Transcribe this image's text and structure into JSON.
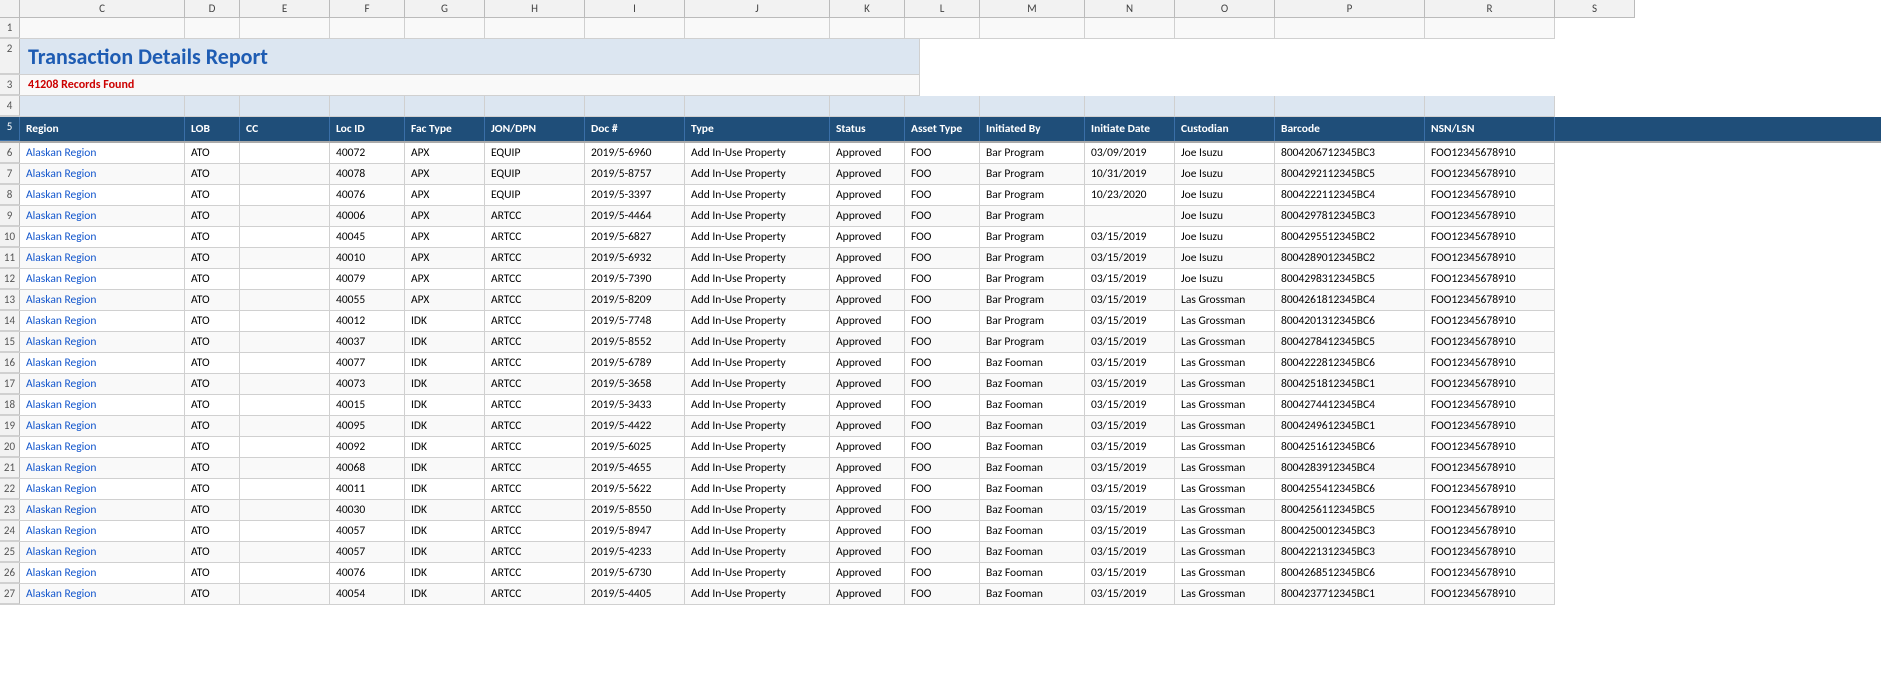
{
  "title": "Transaction Details Report",
  "records_found": "41208 Records Found",
  "columns": [
    {
      "label": "Region",
      "key": "region",
      "cls": "w-region"
    },
    {
      "label": "LOB",
      "key": "lob",
      "cls": "w-lob"
    },
    {
      "label": "CC",
      "key": "cc",
      "cls": "w-cc"
    },
    {
      "label": "Loc ID",
      "key": "loc_id",
      "cls": "w-locid"
    },
    {
      "label": "Fac Type",
      "key": "fac_type",
      "cls": "w-factype"
    },
    {
      "label": "JON/DPN",
      "key": "jon_dpn",
      "cls": "w-jondpn"
    },
    {
      "label": "Doc #",
      "key": "doc_num",
      "cls": "w-docnum"
    },
    {
      "label": "Type",
      "key": "type",
      "cls": "w-type"
    },
    {
      "label": "Status",
      "key": "status",
      "cls": "w-status"
    },
    {
      "label": "Asset Type",
      "key": "asset_type",
      "cls": "w-assettype"
    },
    {
      "label": "Initiated By",
      "key": "init_by",
      "cls": "w-initby"
    },
    {
      "label": "Initiate Date",
      "key": "init_date",
      "cls": "w-initdate"
    },
    {
      "label": "Custodian",
      "key": "custodian",
      "cls": "w-custodian"
    },
    {
      "label": "Barcode",
      "key": "barcode",
      "cls": "w-barcode"
    },
    {
      "label": "NSN/LSN",
      "key": "nsn",
      "cls": "w-nsn"
    }
  ],
  "col_letters": [
    "C",
    "D",
    "E",
    "F",
    "G",
    "H",
    "I",
    "J",
    "K",
    "L",
    "M",
    "N",
    "O",
    "P",
    "R",
    "S"
  ],
  "rows": [
    {
      "region": "Alaskan Region",
      "lob": "ATO",
      "cc": "",
      "loc_id": "40072",
      "fac_type": "APX",
      "jon_dpn": "EQUIP",
      "doc_num": "",
      "type_val": "2019/5-6960",
      "type": "Add In-Use Property",
      "status": "Approved",
      "asset_type": "FOO",
      "init_by": "Bar Program",
      "init_date": "03/09/2019",
      "custodian": "Joe Isuzu",
      "barcode": "8004206712345BC3",
      "nsn": "FOO12345678910"
    },
    {
      "region": "Alaskan Region",
      "lob": "ATO",
      "cc": "",
      "loc_id": "40078",
      "fac_type": "APX",
      "jon_dpn": "EQUIP",
      "doc_num": "",
      "type_val": "2019/5-8757",
      "type": "Add In-Use Property",
      "status": "Approved",
      "asset_type": "FOO",
      "init_by": "Bar Program",
      "init_date": "10/31/2019",
      "custodian": "Joe Isuzu",
      "barcode": "8004292112345BC5",
      "nsn": "FOO12345678910"
    },
    {
      "region": "Alaskan Region",
      "lob": "ATO",
      "cc": "",
      "loc_id": "40076",
      "fac_type": "APX",
      "jon_dpn": "EQUIP",
      "doc_num": "",
      "type_val": "2019/5-3397",
      "type": "Add In-Use Property",
      "status": "Approved",
      "asset_type": "FOO",
      "init_by": "Bar Program",
      "init_date": "10/23/2020",
      "custodian": "Joe Isuzu",
      "barcode": "8004222112345BC4",
      "nsn": "FOO12345678910"
    },
    {
      "region": "Alaskan Region",
      "lob": "ATO",
      "cc": "",
      "loc_id": "40006",
      "fac_type": "APX",
      "jon_dpn": "ARTCC",
      "doc_num": "",
      "type_val": "2019/5-4464",
      "type": "Add In-Use Property",
      "status": "Approved",
      "asset_type": "FOO",
      "init_by": "Bar Program",
      "init_date": "",
      "custodian": "Joe Isuzu",
      "barcode": "8004297812345BC3",
      "nsn": "FOO12345678910"
    },
    {
      "region": "Alaskan Region",
      "lob": "ATO",
      "cc": "",
      "loc_id": "40045",
      "fac_type": "APX",
      "jon_dpn": "ARTCC",
      "doc_num": "",
      "type_val": "2019/5-6827",
      "type": "Add In-Use Property",
      "status": "Approved",
      "asset_type": "FOO",
      "init_by": "Bar Program",
      "init_date": "03/15/2019",
      "custodian": "Joe Isuzu",
      "barcode": "8004295512345BC2",
      "nsn": "FOO12345678910"
    },
    {
      "region": "Alaskan Region",
      "lob": "ATO",
      "cc": "",
      "loc_id": "40010",
      "fac_type": "APX",
      "jon_dpn": "ARTCC",
      "doc_num": "",
      "type_val": "2019/5-6932",
      "type": "Add In-Use Property",
      "status": "Approved",
      "asset_type": "FOO",
      "init_by": "Bar Program",
      "init_date": "03/15/2019",
      "custodian": "Joe Isuzu",
      "barcode": "8004289012345BC2",
      "nsn": "FOO12345678910"
    },
    {
      "region": "Alaskan Region",
      "lob": "ATO",
      "cc": "",
      "loc_id": "40079",
      "fac_type": "APX",
      "jon_dpn": "ARTCC",
      "doc_num": "",
      "type_val": "2019/5-7390",
      "type": "Add In-Use Property",
      "status": "Approved",
      "asset_type": "FOO",
      "init_by": "Bar Program",
      "init_date": "03/15/2019",
      "custodian": "Joe Isuzu",
      "barcode": "8004298312345BC5",
      "nsn": "FOO12345678910"
    },
    {
      "region": "Alaskan Region",
      "lob": "ATO",
      "cc": "",
      "loc_id": "40055",
      "fac_type": "APX",
      "jon_dpn": "ARTCC",
      "doc_num": "",
      "type_val": "2019/5-8209",
      "type": "Add In-Use Property",
      "status": "Approved",
      "asset_type": "FOO",
      "init_by": "Bar Program",
      "init_date": "03/15/2019",
      "custodian": "Las Grossman",
      "barcode": "8004261812345BC4",
      "nsn": "FOO12345678910"
    },
    {
      "region": "Alaskan Region",
      "lob": "ATO",
      "cc": "",
      "loc_id": "40012",
      "fac_type": "IDK",
      "jon_dpn": "ARTCC",
      "doc_num": "",
      "type_val": "2019/5-7748",
      "type": "Add In-Use Property",
      "status": "Approved",
      "asset_type": "FOO",
      "init_by": "Bar Program",
      "init_date": "03/15/2019",
      "custodian": "Las Grossman",
      "barcode": "8004201312345BC6",
      "nsn": "FOO12345678910"
    },
    {
      "region": "Alaskan Region",
      "lob": "ATO",
      "cc": "",
      "loc_id": "40037",
      "fac_type": "IDK",
      "jon_dpn": "ARTCC",
      "doc_num": "",
      "type_val": "2019/5-8552",
      "type": "Add In-Use Property",
      "status": "Approved",
      "asset_type": "FOO",
      "init_by": "Bar Program",
      "init_date": "03/15/2019",
      "custodian": "Las Grossman",
      "barcode": "8004278412345BC5",
      "nsn": "FOO12345678910"
    },
    {
      "region": "Alaskan Region",
      "lob": "ATO",
      "cc": "",
      "loc_id": "40077",
      "fac_type": "IDK",
      "jon_dpn": "ARTCC",
      "doc_num": "",
      "type_val": "2019/5-6789",
      "type": "Add In-Use Property",
      "status": "Approved",
      "asset_type": "FOO",
      "init_by": "Baz Fooman",
      "init_date": "03/15/2019",
      "custodian": "Las Grossman",
      "barcode": "8004222812345BC6",
      "nsn": "FOO12345678910"
    },
    {
      "region": "Alaskan Region",
      "lob": "ATO",
      "cc": "",
      "loc_id": "40073",
      "fac_type": "IDK",
      "jon_dpn": "ARTCC",
      "doc_num": "",
      "type_val": "2019/5-3658",
      "type": "Add In-Use Property",
      "status": "Approved",
      "asset_type": "FOO",
      "init_by": "Baz Fooman",
      "init_date": "03/15/2019",
      "custodian": "Las Grossman",
      "barcode": "8004251812345BC1",
      "nsn": "FOO12345678910"
    },
    {
      "region": "Alaskan Region",
      "lob": "ATO",
      "cc": "",
      "loc_id": "40015",
      "fac_type": "IDK",
      "jon_dpn": "ARTCC",
      "doc_num": "",
      "type_val": "2019/5-3433",
      "type": "Add In-Use Property",
      "status": "Approved",
      "asset_type": "FOO",
      "init_by": "Baz Fooman",
      "init_date": "03/15/2019",
      "custodian": "Las Grossman",
      "barcode": "8004274412345BC4",
      "nsn": "FOO12345678910"
    },
    {
      "region": "Alaskan Region",
      "lob": "ATO",
      "cc": "",
      "loc_id": "40095",
      "fac_type": "IDK",
      "jon_dpn": "ARTCC",
      "doc_num": "",
      "type_val": "2019/5-4422",
      "type": "Add In-Use Property",
      "status": "Approved",
      "asset_type": "FOO",
      "init_by": "Baz Fooman",
      "init_date": "03/15/2019",
      "custodian": "Las Grossman",
      "barcode": "8004249612345BC1",
      "nsn": "FOO12345678910"
    },
    {
      "region": "Alaskan Region",
      "lob": "ATO",
      "cc": "",
      "loc_id": "40092",
      "fac_type": "IDK",
      "jon_dpn": "ARTCC",
      "doc_num": "",
      "type_val": "2019/5-6025",
      "type": "Add In-Use Property",
      "status": "Approved",
      "asset_type": "FOO",
      "init_by": "Baz Fooman",
      "init_date": "03/15/2019",
      "custodian": "Las Grossman",
      "barcode": "8004251612345BC6",
      "nsn": "FOO12345678910"
    },
    {
      "region": "Alaskan Region",
      "lob": "ATO",
      "cc": "",
      "loc_id": "40068",
      "fac_type": "IDK",
      "jon_dpn": "ARTCC",
      "doc_num": "",
      "type_val": "2019/5-4655",
      "type": "Add In-Use Property",
      "status": "Approved",
      "asset_type": "FOO",
      "init_by": "Baz Fooman",
      "init_date": "03/15/2019",
      "custodian": "Las Grossman",
      "barcode": "8004283912345BC4",
      "nsn": "FOO12345678910"
    },
    {
      "region": "Alaskan Region",
      "lob": "ATO",
      "cc": "",
      "loc_id": "40011",
      "fac_type": "IDK",
      "jon_dpn": "ARTCC",
      "doc_num": "",
      "type_val": "2019/5-5622",
      "type": "Add In-Use Property",
      "status": "Approved",
      "asset_type": "FOO",
      "init_by": "Baz Fooman",
      "init_date": "03/15/2019",
      "custodian": "Las Grossman",
      "barcode": "8004255412345BC6",
      "nsn": "FOO12345678910"
    },
    {
      "region": "Alaskan Region",
      "lob": "ATO",
      "cc": "",
      "loc_id": "40030",
      "fac_type": "IDK",
      "jon_dpn": "ARTCC",
      "doc_num": "",
      "type_val": "2019/5-8550",
      "type": "Add In-Use Property",
      "status": "Approved",
      "asset_type": "FOO",
      "init_by": "Baz Fooman",
      "init_date": "03/15/2019",
      "custodian": "Las Grossman",
      "barcode": "8004256112345BC5",
      "nsn": "FOO12345678910"
    },
    {
      "region": "Alaskan Region",
      "lob": "ATO",
      "cc": "",
      "loc_id": "40057",
      "fac_type": "IDK",
      "jon_dpn": "ARTCC",
      "doc_num": "",
      "type_val": "2019/5-8947",
      "type": "Add In-Use Property",
      "status": "Approved",
      "asset_type": "FOO",
      "init_by": "Baz Fooman",
      "init_date": "03/15/2019",
      "custodian": "Las Grossman",
      "barcode": "8004250012345BC3",
      "nsn": "FOO12345678910"
    },
    {
      "region": "Alaskan Region",
      "lob": "ATO",
      "cc": "",
      "loc_id": "40057",
      "fac_type": "IDK",
      "jon_dpn": "ARTCC",
      "doc_num": "",
      "type_val": "2019/5-4233",
      "type": "Add In-Use Property",
      "status": "Approved",
      "asset_type": "FOO",
      "init_by": "Baz Fooman",
      "init_date": "03/15/2019",
      "custodian": "Las Grossman",
      "barcode": "8004221312345BC3",
      "nsn": "FOO12345678910"
    },
    {
      "region": "Alaskan Region",
      "lob": "ATO",
      "cc": "",
      "loc_id": "40076",
      "fac_type": "IDK",
      "jon_dpn": "ARTCC",
      "doc_num": "",
      "type_val": "2019/5-6730",
      "type": "Add In-Use Property",
      "status": "Approved",
      "asset_type": "FOO",
      "init_by": "Baz Fooman",
      "init_date": "03/15/2019",
      "custodian": "Las Grossman",
      "barcode": "8004268512345BC6",
      "nsn": "FOO12345678910"
    },
    {
      "region": "Alaskan Region",
      "lob": "ATO",
      "cc": "",
      "loc_id": "40054",
      "fac_type": "IDK",
      "jon_dpn": "ARTCC",
      "doc_num": "",
      "type_val": "2019/5-4405",
      "type": "Add In-Use Property",
      "status": "Approved",
      "asset_type": "FOO",
      "init_by": "Baz Fooman",
      "init_date": "03/15/2019",
      "custodian": "Las Grossman",
      "barcode": "8004237712345BC1",
      "nsn": "FOO12345678910"
    }
  ],
  "row_numbers": [
    1,
    2,
    3,
    4,
    5,
    6,
    7,
    8,
    9,
    10,
    11,
    12,
    13,
    14,
    15,
    16,
    17,
    18,
    19,
    20,
    21,
    22,
    23,
    24,
    25,
    26,
    27
  ]
}
